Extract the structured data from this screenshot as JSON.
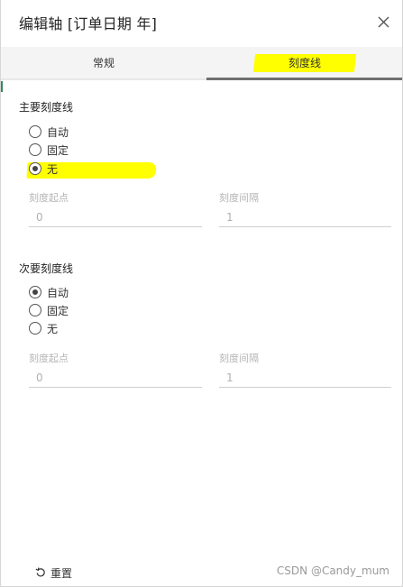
{
  "dialog": {
    "title": "编辑轴 [订单日期 年]",
    "close_icon": "close-icon"
  },
  "tabs": [
    {
      "label": "常规",
      "active": false
    },
    {
      "label": "刻度线",
      "active": true
    }
  ],
  "major": {
    "title": "主要刻度线",
    "options": [
      {
        "label": "自动",
        "checked": false
      },
      {
        "label": "固定",
        "checked": false
      },
      {
        "label": "无",
        "checked": true
      }
    ],
    "start_label": "刻度起点",
    "start_value": "0",
    "interval_label": "刻度间隔",
    "interval_value": "1"
  },
  "minor": {
    "title": "次要刻度线",
    "options": [
      {
        "label": "自动",
        "checked": true
      },
      {
        "label": "固定",
        "checked": false
      },
      {
        "label": "无",
        "checked": false
      }
    ],
    "start_label": "刻度起点",
    "start_value": "0",
    "interval_label": "刻度间隔",
    "interval_value": "1"
  },
  "footer": {
    "reset_label": "重置",
    "reset_icon": "undo-icon",
    "watermark": "CSDN @Candy_mum"
  },
  "colors": {
    "highlight": "#ffff00",
    "active_tab_border": "#707070",
    "muted_text": "#b5b5b5"
  }
}
